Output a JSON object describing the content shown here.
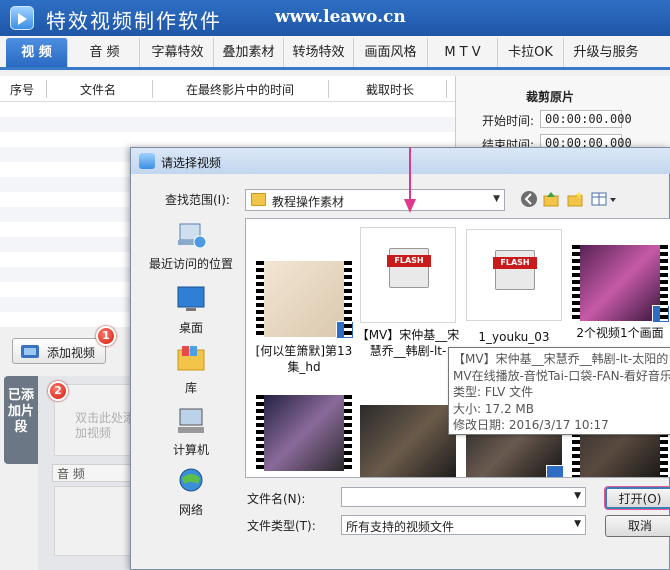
{
  "app": {
    "title": "特效视频制作软件",
    "url": "www.leawo.cn"
  },
  "menu": [
    "视 频",
    "音 频",
    "字幕特效",
    "叠加素材",
    "转场特效",
    "画面风格",
    "M T V",
    "卡拉OK",
    "升级与服务"
  ],
  "clip_table": {
    "columns": [
      "序号",
      "文件名",
      "在最终影片中的时间",
      "截取时长"
    ]
  },
  "trim": {
    "title": "裁剪原片",
    "start_label": "开始时间:",
    "start_value": "00:00:00.000",
    "end_label": "结束时间:",
    "end_value": "00:00:00.000"
  },
  "left": {
    "add_video": "添加视频",
    "badge1": "1",
    "badge2": "2",
    "added_segments": "已添加片段",
    "segment_hint": "双击此处添加视频",
    "audio": "音 频"
  },
  "dialog": {
    "title": "请选择视频",
    "lookin_label": "查找范围(I):",
    "lookin_value": "教程操作素材",
    "places": [
      "最近访问的位置",
      "桌面",
      "库",
      "计算机",
      "网络"
    ],
    "files": [
      {
        "name": "[何以笙箫默]第13集_hd",
        "kind": "video"
      },
      {
        "name": "【MV】宋仲基__宋慧乔__韩剧-lt-",
        "kind": "flash"
      },
      {
        "name": "1_youku_03",
        "kind": "flash"
      },
      {
        "name": "2个视频1个画面",
        "kind": "video"
      },
      {
        "name": "",
        "kind": "video"
      },
      {
        "name": "",
        "kind": "video"
      },
      {
        "name": "",
        "kind": "video"
      },
      {
        "name": "",
        "kind": "video"
      }
    ],
    "tooltip": [
      "【MV】宋仲基__宋慧乔__韩剧-lt-太阳的",
      "MV在线播放-音悦Tai-口袋-FAN-看好音乐",
      "类型: FLV 文件",
      "大小: 17.2 MB",
      "修改日期: 2016/3/17 10:17"
    ],
    "filename_label": "文件名(N):",
    "filename_value": "",
    "filetype_label": "文件类型(T):",
    "filetype_value": "所有支持的视频文件",
    "open_button": "打开(O)",
    "cancel_button": "取消"
  },
  "colors": {
    "accent": "#2a69c2",
    "badge": "#d31a10",
    "arrow": "#e0388a"
  }
}
